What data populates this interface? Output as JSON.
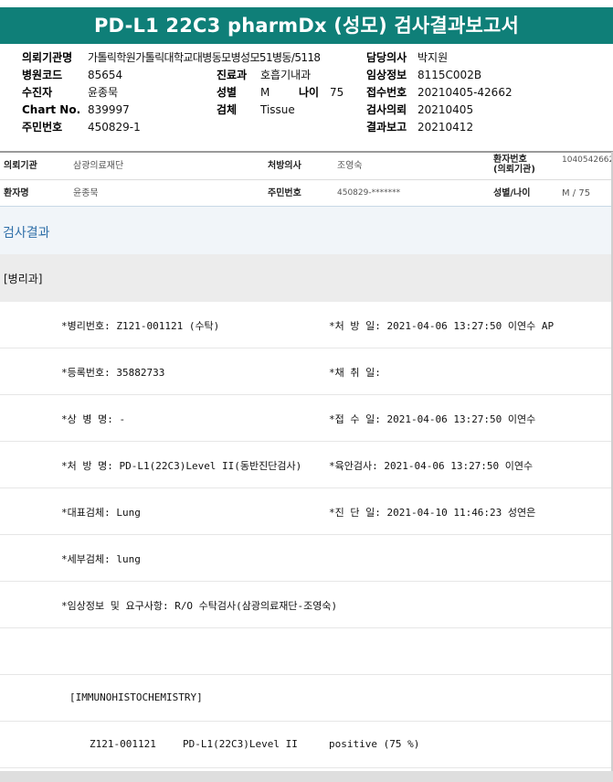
{
  "title": "PD-L1 22C3 pharmDx (성모) 검사결과보고서",
  "header": {
    "institution_label": "의뢰기관명",
    "institution_value": "가톨릭학원가톨릭대학교대병동모병성모51병동/5118",
    "doctor_label": "담당의사",
    "doctor_value": "박지원",
    "hospital_code_label": "병원코드",
    "hospital_code_value": "85654",
    "dept_label": "진료과",
    "dept_value": "호흡기내과",
    "clinical_label": "임상정보",
    "clinical_value": "8115C002B",
    "patient_label": "수진자",
    "patient_value": "윤종묵",
    "sex_label": "성별",
    "sex_value": "M",
    "age_label": "나이",
    "age_value": "75",
    "receipt_label": "접수번호",
    "receipt_value": "20210405-42662",
    "chart_label": "Chart No.",
    "chart_value": "839997",
    "specimen_label": "검체",
    "specimen_value": "Tissue",
    "request_label": "검사의뢰",
    "request_value": "20210405",
    "ssn_label": "주민번호",
    "ssn_value": "450829-1",
    "report_label": "결과보고",
    "report_value": "20210412"
  },
  "patient_info": {
    "req_inst_label": "의뢰기관",
    "req_inst_value": "삼광의료재단",
    "prescriber_label": "처방의사",
    "prescriber_value": "조영숙",
    "patient_no_label_1": "환자번호",
    "patient_no_label_2": "(의뢰기관)",
    "patient_no_value": "1040542662",
    "name_label": "환자명",
    "name_value": "윤종묵",
    "ssn_label": "주민번호",
    "ssn_value": "450829-*******",
    "sexage_label": "성별/나이",
    "sexage_value": "M / 75"
  },
  "section_title": "검사결과",
  "department": "[병리과]",
  "results": [
    {
      "left": "*병리번호: Z121-001121 (수탁)",
      "right": "*처 방 일: 2021-04-06 13:27:50  이연수 AP"
    },
    {
      "left": "*등록번호: 35882733",
      "right": "*채 취 일:"
    },
    {
      "left": "*상 병 명: -",
      "right": "*접 수 일: 2021-04-06 13:27:50  이연수"
    },
    {
      "left": "*처 방 명: PD-L1(22C3)Level II(동반진단검사)",
      "right": "*육안검사: 2021-04-06 13:27:50  이연수"
    },
    {
      "left": "*대표검체: Lung",
      "right": "*진 단 일: 2021-04-10 11:46:23  성연은"
    },
    {
      "left": "*세부검체: lung",
      "right": ""
    },
    {
      "left": "*임상정보 및 요구사항: R/O 수탁검사(삼광의료재단-조영숙)",
      "right": ""
    }
  ],
  "ihc_header": "[IMMUNOHISTOCHEMISTRY]",
  "ihc_row": {
    "id": "Z121-001121",
    "test": "PD-L1(22C3)Level II",
    "result": "positive (75 %)"
  }
}
